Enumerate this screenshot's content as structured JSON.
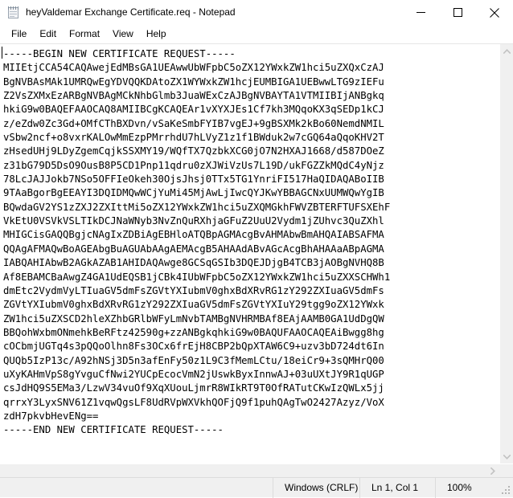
{
  "window": {
    "title": "heyValdemar Exchange Certificate.req - Notepad",
    "icon": "notepad-icon",
    "controls": {
      "minimize": "minimize-icon",
      "maximize": "maximize-icon",
      "close": "close-icon"
    }
  },
  "menu": {
    "items": [
      {
        "label": "File"
      },
      {
        "label": "Edit"
      },
      {
        "label": "Format"
      },
      {
        "label": "View"
      },
      {
        "label": "Help"
      }
    ]
  },
  "editor": {
    "lines": [
      "-----BEGIN NEW CERTIFICATE REQUEST-----",
      "MIIEtjCCA54CAQAwejEdMBsGA1UEAwwUbWFpbC5oZX12YWxkZW1hci5uZXQxCzAJ",
      "BgNVBAsMAk1UMRQwEgYDVQQKDAtoZX1WYWxkZW1hcjEUMBIGA1UEBwwLTG9zIEFu",
      "Z2VsZXMxEzARBgNVBAgMCkNhbGlmb3JuaWExCzAJBgNVBAYTA1VTMIIBIjANBgkq",
      "hkiG9w0BAQEFAAOCAQ8AMIIBCgKCAQEAr1vXYXJEs1Cf7kh3MQqoKX3qSEDp1kCJ",
      "z/eZdw0Zc3Gd+OMfCThBXDvn/vSaKeSmbFYIB7vgEJ+9gBSXMk2kBo60NemdNMIL",
      "vSbw2ncf+o8vxrKALOwMmEzpPMrrhdU7hLVyZ1z1f1BWduk2w7cGQ64aQqoKHV2T",
      "zHsedUHj9LDyZgemCqjkSSXMY19/WQfTX7QzbkXCG0jO7N2HXAJ1668/d587DOeZ",
      "z31bG79D5DsO9OusB8P5CD1Pnp11qdru0zXJWiVzUs7L19D/ukFGZZkMQdC4yNjz",
      "78LcJAJJokb7NSo5OFFIeOkeh30OjsJhsj0TTx5TG1YnriFI517HaQIDAQABoIIB",
      "9TAaBgorBgEEAYI3DQIDMQwWCjYuMi45MjAwLjIwcQYJKwYBBAGCNxUUMWQwYgIB",
      "BQwdaGV2YS1zZXJ2ZXIttMi5oZX12YWxkZW1hci5uZXQMGkhFWVZBTERFTUFSXEhF",
      "VkEtU0VSVkVSLTIkDCJNaWNyb3NvZnQuRXhjaGFuZ2UuU2Vydm1jZUhvc3QuZXhl",
      "MHIGCisGAQQBgjcNAgIxZDBiAgEBHloATQBpAGMAcgBvAHMAbwBmAHQAIABSAFMA",
      "QQAgAFMAQwBoAGEAbgBuAGUAbAAgAEMAcgB5AHAAdABvAGcAcgBhAHAAaABpAGMA",
      "IABQAHIAbwB2AGkAZAB1AHIDAQAwge8GCSqGSIb3DQEJDjgB4TCB3jAOBgNVHQ8B",
      "Af8EBAMCBaAwgZ4GA1UdEQSB1jCBk4IUbWFpbC5oZX12YWxkZW1hci5uZXXSCHWh1",
      "dmEtc2VydmVyLTIuaGV5dmFsZGVtYXIubmV0ghxBdXRvRG1zY292ZXIuaGV5dmFs",
      "ZGVtYXIubmV0ghxBdXRvRG1zY292ZXIuaGV5dmFsZGVtYXIuY29tgg9oZX12YWxk",
      "ZW1hci5uZXSCD2hleXZhbGRlbWFyLmNvbTAMBgNVHRMBAf8EAjAAMB0GA1UdDgQW",
      "BBQohWxbmONmehkBeRFtz42590g+zzANBgkqhkiG9w0BAQUFAAOCAQEAiBwgg8hg",
      "cOCbmjUGTq4s3pQQoOlhn8Fs3OCx6frEjH8CBP2bQpXTAW6C9+uzv3bD724dt6In",
      "QUQb5IzP13c/A92hNSj3D5n3afEnFy50z1L9C3fMemLCtu/18eiCr9+3sQMHrQ00",
      "uXyKAHmVpS8gYvguCfNwi2YUCpEcocVmN2jUswkByxInnwAJ+03uUXtJY9R1qUGP",
      "csJdHQ9S5EMa3/LzwV34vuOf9XqXUouLjmrR8WIkRT9T0OfRATutCKwIzQWLx5jj",
      "qrrxY3LyxSNV61Z1vqwQgsLF8UdRVpWXVkhQOFjQ9f1puhQAgTwO2427Azyz/VoX",
      "zdH7pkvbHevENg==",
      "-----END NEW CERTIFICATE REQUEST-----"
    ]
  },
  "scrollbars": {
    "vertical": {
      "up_arrow": "scroll-up-icon",
      "down_arrow": "scroll-down-icon"
    },
    "horizontal": {
      "right_arrow": "scroll-right-icon"
    }
  },
  "statusbar": {
    "encoding": "Windows (CRLF)",
    "position": "Ln 1, Col 1",
    "zoom": "100%",
    "grip": "resize-grip-icon"
  },
  "colors": {
    "window_bg": "#ffffff",
    "text": "#000000",
    "chrome": "#f0f0f0",
    "divider": "#dcdcdc",
    "scroll_arrow": "#c2c2c2"
  }
}
